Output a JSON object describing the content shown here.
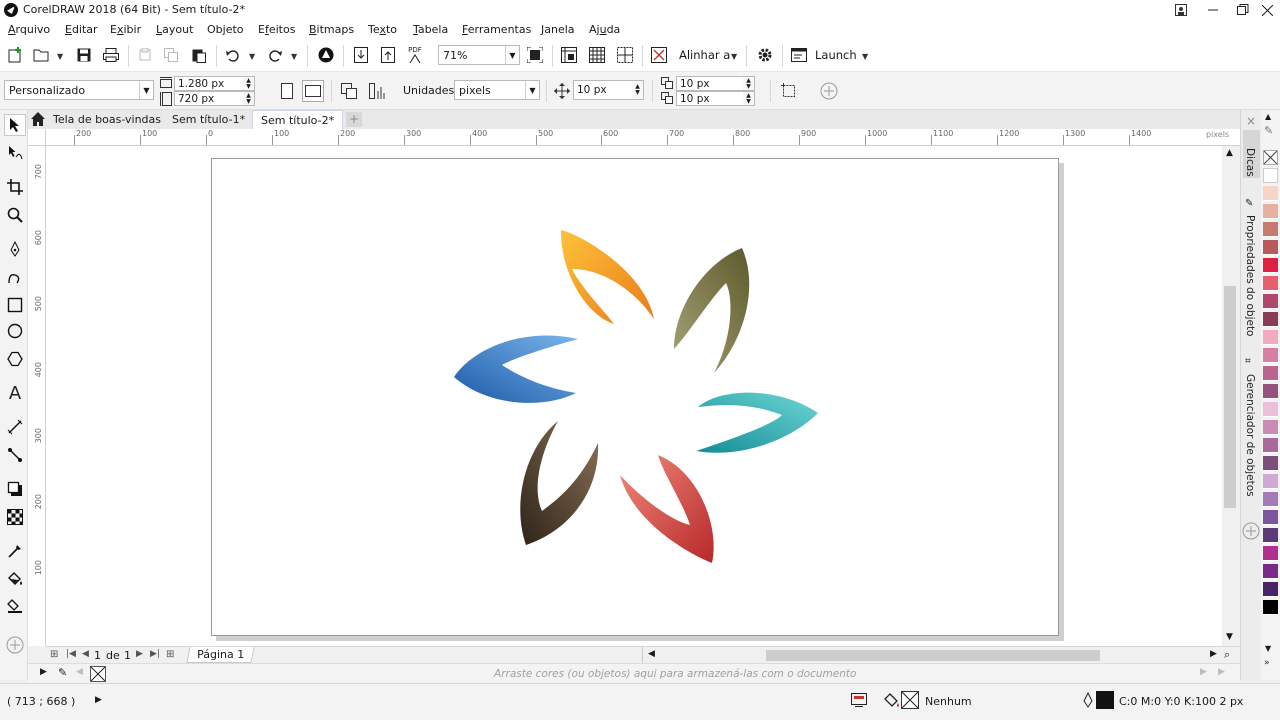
{
  "window": {
    "title": "CorelDRAW 2018 (64 Bit) - Sem título-2*",
    "buttons": [
      "minimize",
      "restore",
      "close"
    ]
  },
  "menu": [
    {
      "label": "Arquivo",
      "hotkey": "A"
    },
    {
      "label": "Editar",
      "hotkey": "E"
    },
    {
      "label": "Exibir",
      "hotkey": "x"
    },
    {
      "label": "Layout",
      "hotkey": "L"
    },
    {
      "label": "Objeto",
      "hotkey": "j"
    },
    {
      "label": "Efeitos",
      "hotkey": "f"
    },
    {
      "label": "Bitmaps",
      "hotkey": "B"
    },
    {
      "label": "Texto",
      "hotkey": "x"
    },
    {
      "label": "Tabela",
      "hotkey": "T"
    },
    {
      "label": "Ferramentas",
      "hotkey": "F"
    },
    {
      "label": "Janela",
      "hotkey": "J"
    },
    {
      "label": "Ajuda",
      "hotkey": "u"
    }
  ],
  "toolbar": {
    "zoom_value": "71%",
    "align_label": "Alinhar a",
    "launch_label": "Launch",
    "pdf_label": "PDF"
  },
  "property_bar": {
    "page_preset": "Personalizado",
    "width": "1.280 px",
    "height": "720 px",
    "units_label": "Unidades:",
    "units_value": "pixels",
    "nudge": "10 px",
    "dup_x": "10 px",
    "dup_y": "10 px"
  },
  "tabs": [
    {
      "label": "Tela de boas-vindas",
      "active": false
    },
    {
      "label": "Sem título-1*",
      "active": false
    },
    {
      "label": "Sem título-2*",
      "active": true
    }
  ],
  "rulers": {
    "h_ticks": [
      "200",
      "100",
      "0",
      "100",
      "200",
      "300",
      "400",
      "500",
      "600",
      "700",
      "800",
      "900",
      "1000",
      "1100",
      "1200",
      "1300",
      "1400"
    ],
    "h_units": "pixels",
    "v_ticks": [
      "700",
      "600",
      "500",
      "400",
      "300",
      "200",
      "100"
    ]
  },
  "docker_tabs": [
    "Dicas",
    "Propriedades do objeto",
    "Gerenciador de objetos"
  ],
  "palette": [
    "#ffffff",
    "#f5d6c6",
    "#e8b0a0",
    "#c97a6e",
    "#b85a5a",
    "#e02040",
    "#e75e6e",
    "#b0486a",
    "#8a3b58",
    "#f2a9c1",
    "#d87ea3",
    "#b9668f",
    "#96527a",
    "#eac0d8",
    "#c98cb5",
    "#a86a9a",
    "#7d4d7b",
    "#d0a8d6",
    "#a47ab8",
    "#7c569c",
    "#5a3a78",
    "#b03090",
    "#7a2a8a",
    "#4a2266",
    "#000000"
  ],
  "page_nav": {
    "current": "1",
    "of_label": "de",
    "total": "1",
    "page_tab": "Página 1"
  },
  "color_well_hint": "Arraste cores (ou objetos) aqui para armazená-las com o documento",
  "status": {
    "coords": "( 713  ; 668  )",
    "fill_label": "Nenhum",
    "outline_label": "C:0 M:0 Y:0 K:100  2 px"
  },
  "colors": {
    "petal_blue": "#2f72c4",
    "petal_orange": "#f39a1f",
    "petal_olive": "#736e3e",
    "petal_teal": "#1ba9b4",
    "petal_red": "#d7413a",
    "petal_brown": "#4a3a26"
  }
}
